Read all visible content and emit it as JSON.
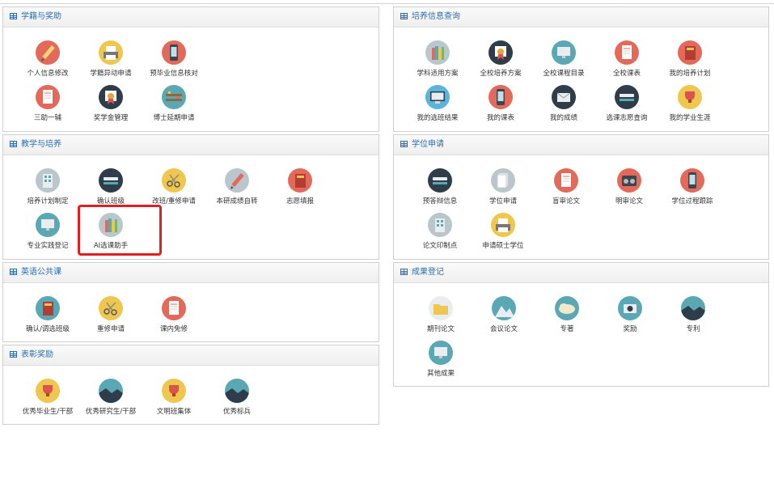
{
  "panels": {
    "xueji": {
      "title": "学籍与奖助",
      "items": [
        "个人信息修改",
        "学籍异动申请",
        "预毕业信息核对",
        "三助一辅",
        "奖学金管理",
        "博士延期申请"
      ]
    },
    "peiyang_info": {
      "title": "培养信息查询",
      "items": [
        "学科适用方案",
        "全校培养方案",
        "全校课程目录",
        "全校课表",
        "我的培养计划",
        "我的选班结果",
        "我的课表",
        "我的成绩",
        "选课志愿查询",
        "我的学业生涯"
      ]
    },
    "jiaoxue": {
      "title": "教学与培养",
      "items": [
        "培养计划制定",
        "确认班级",
        "改班/重修申请",
        "本研成绩自转",
        "志愿填报",
        "专业实践登记",
        "AI选课助手"
      ]
    },
    "xuewei": {
      "title": "学位申请",
      "items": [
        "预答辩信息",
        "学位申请",
        "盲审论文",
        "明审论文",
        "学位过程跟踪",
        "论文印制点",
        "申请硕士学位"
      ]
    },
    "yingyu": {
      "title": "英语公共课",
      "items": [
        "确认/调选班级",
        "重修申请",
        "课内免修"
      ]
    },
    "chengguo": {
      "title": "成果登记",
      "items": [
        "期刊论文",
        "会议论文",
        "专著",
        "奖励",
        "专利",
        "其他成果"
      ]
    },
    "biaozhang": {
      "title": "表彰奖励",
      "items": [
        "优秀毕业生/干部",
        "优秀研究生/干部",
        "文明班集体",
        "优秀标兵"
      ]
    }
  },
  "colors": {
    "panel_title": "#2a6eb0",
    "highlight_box": "#e02020",
    "icon_bg_red": "#e36a5a",
    "icon_bg_yellow": "#efc64e",
    "icon_bg_teal": "#5aa8b4",
    "icon_bg_dark": "#2f3d4a",
    "icon_bg_grey": "#b9c6cc"
  },
  "icons": {
    "xueji": [
      "pencil-icon",
      "printer-icon",
      "phone-icon",
      "document-icon",
      "award-ribbon-icon",
      "bookshelf-icon"
    ],
    "peiyang_info": [
      "books-icon",
      "award-ribbon-icon",
      "monitor-icon",
      "document-icon",
      "book-icon",
      "desktop-icon",
      "phone-icon",
      "mail-icon",
      "stapler-icon",
      "trophy-icon"
    ],
    "jiaoxue": [
      "building-icon",
      "stapler-icon",
      "scissors-icon",
      "pencil-icon",
      "book-icon",
      "monitor-icon",
      "books-icon"
    ],
    "xuewei": [
      "stapler-icon",
      "paper-stack-icon",
      "document-icon",
      "radio-icon",
      "phone-icon",
      "building-icon",
      "printer-icon"
    ],
    "yingyu": [
      "book-icon",
      "scissors-icon",
      "document-icon"
    ],
    "chengguo": [
      "folder-icon",
      "landscape-icon",
      "cloud-icon",
      "camera-icon",
      "mountain-icon",
      "monitor-icon"
    ],
    "biaozhang": [
      "trophy-icon",
      "mountain-icon",
      "trophy-icon",
      "mountain-icon"
    ]
  }
}
